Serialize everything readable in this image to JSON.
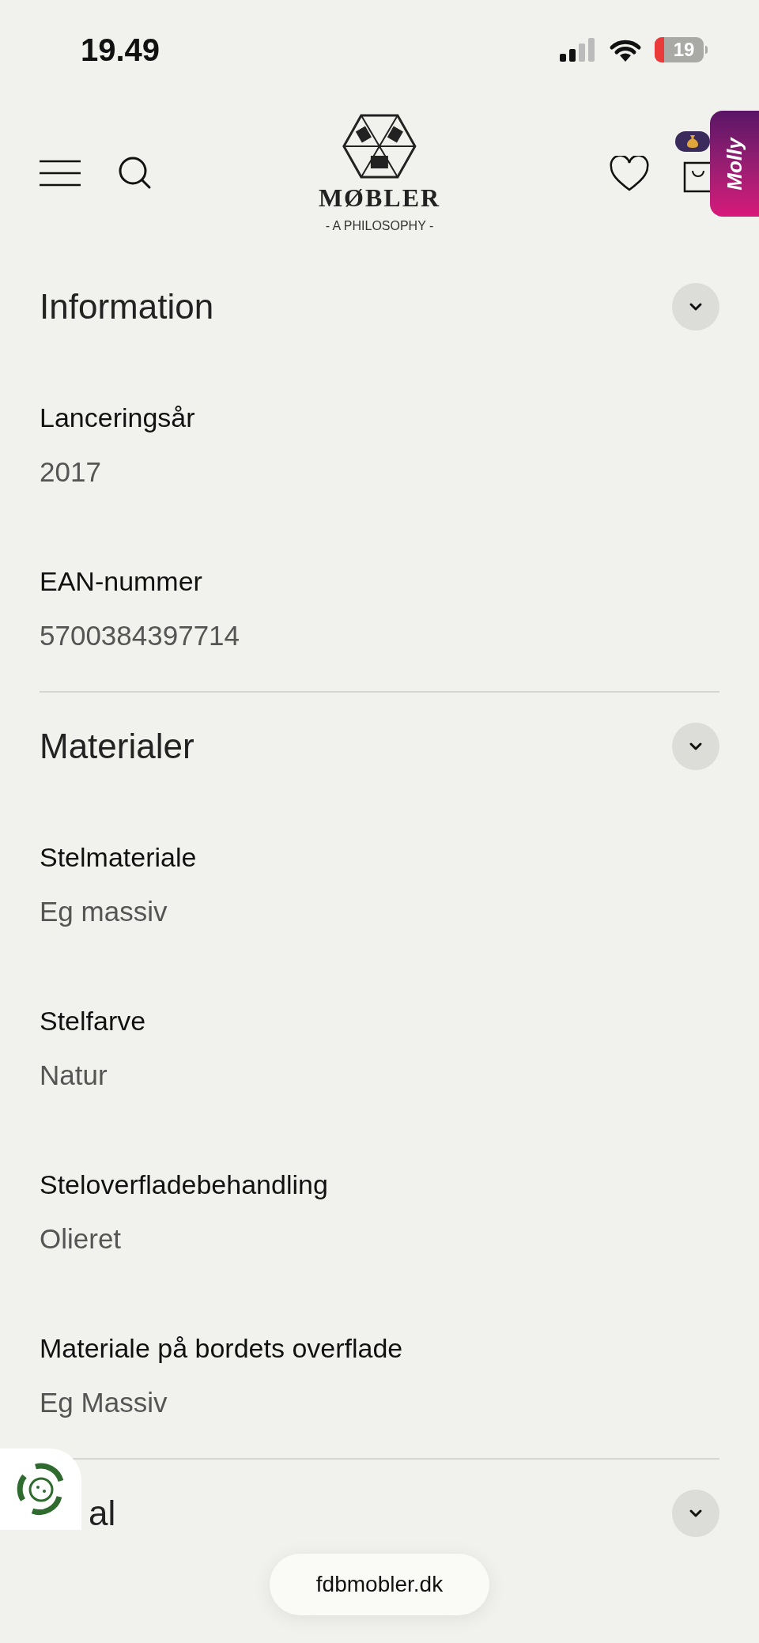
{
  "status_bar": {
    "time": "19.49",
    "battery": "19"
  },
  "header": {
    "logo_wordmark": "MØBLER",
    "logo_tagline": "- A PHILOSOPHY -",
    "side_tab": "Molly"
  },
  "sections": [
    {
      "title": "Information",
      "fields": [
        {
          "label": "Lanceringsår",
          "value": "2017"
        },
        {
          "label": "EAN-nummer",
          "value": "5700384397714"
        }
      ]
    },
    {
      "title": "Materialer",
      "fields": [
        {
          "label": "Stelmateriale",
          "value": "Eg massiv"
        },
        {
          "label": "Stelfarve",
          "value": "Natur"
        },
        {
          "label": "Steloverfladebehandling",
          "value": "Olieret"
        },
        {
          "label": "Materiale på bordets overflade",
          "value": "Eg Massiv"
        }
      ]
    },
    {
      "title": "al"
    }
  ],
  "address_bar": {
    "url": "fdbmobler.dk"
  }
}
